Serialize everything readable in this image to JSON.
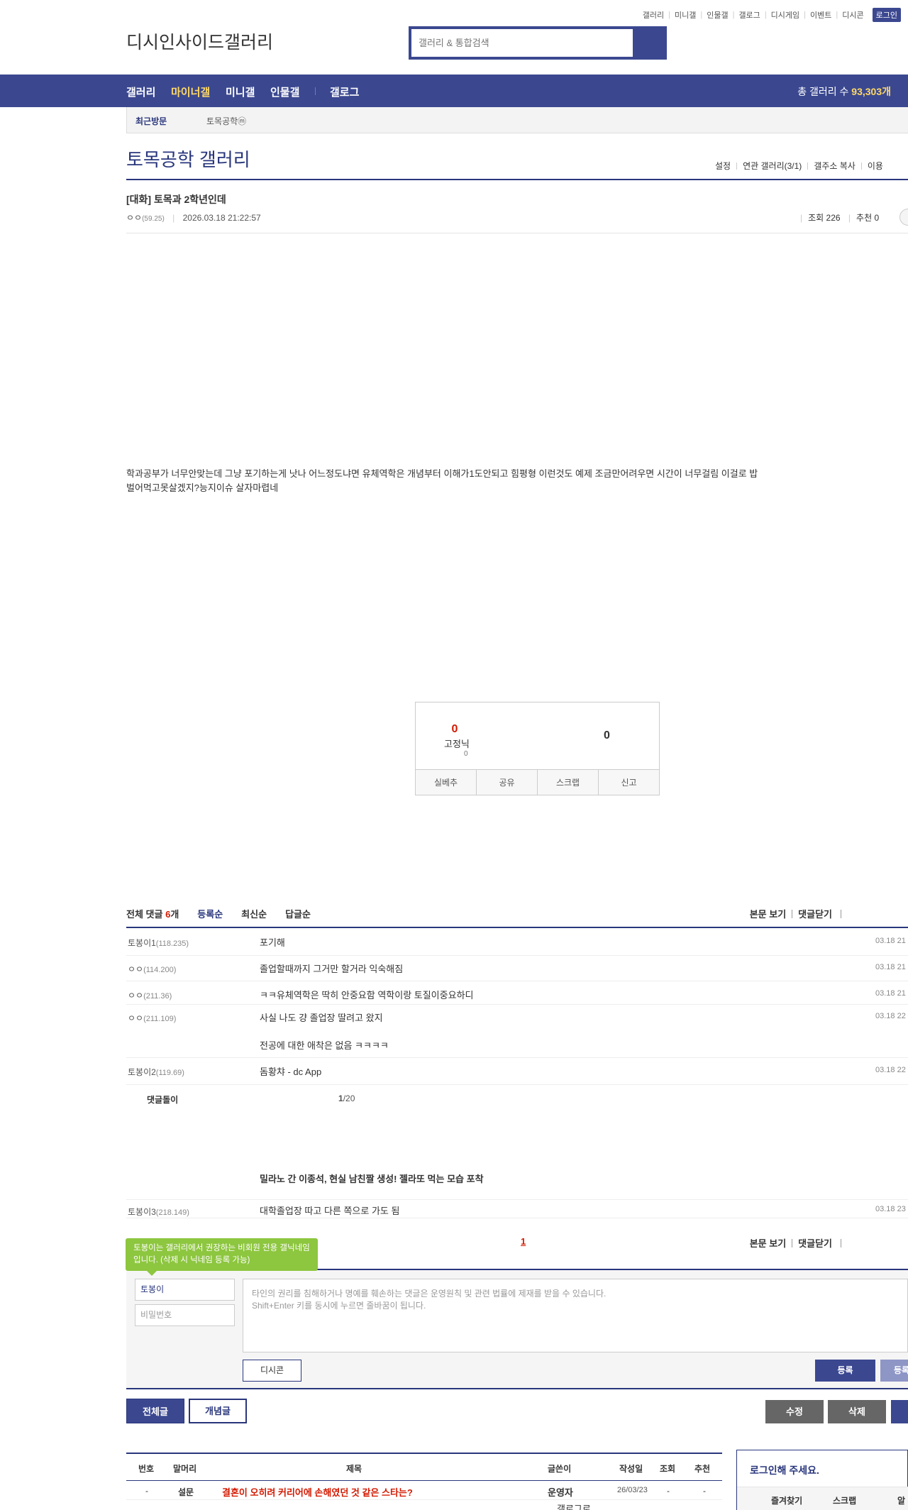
{
  "topnav": [
    "갤러리",
    "미니갤",
    "인물갤",
    "갤로그",
    "디시게임",
    "이벤트",
    "디시콘"
  ],
  "login_label": "로그인",
  "logo_alt": "디시인사이드",
  "logo_sub_alt": "갤러리",
  "search": {
    "placeholder": "갤러리 & 통합검색"
  },
  "gnb": {
    "items": [
      "갤러리",
      "마이너갤",
      "미니갤",
      "인물갤",
      "갤로그"
    ],
    "count_label": "총 갤러리 수",
    "count_value": "93,303개"
  },
  "recent": {
    "label": "최근방문",
    "item": "토목공학ⓜ"
  },
  "gallery": {
    "title": "토목공학 갤러리",
    "tools": [
      "설정",
      "연관 갤러리(3/1)",
      "갤주소 복사",
      "이용"
    ]
  },
  "post": {
    "title": "[대화] 토목과 2학년인데",
    "author": "ㅇㅇ",
    "author_ip": "(59.25)",
    "date": "2026.03.18 21:22:57",
    "views_label": "조회 226",
    "recommend_label": "추천 0",
    "body": "학과공부가 너무안맞는데 그냥 포기하는게 낫나 어느정도냐면 유체역학은 개념부터 이해가1도안되고 힘평형 이런것도 예제 조금만어려우면 시간이 너무걸림 이걸로 밥벌어먹고못살겠지?능지이슈 살자마렵네"
  },
  "recommend": {
    "up_count": "0",
    "fixed_alt": "고정닉",
    "fixed_count": "0",
    "down_count": "0",
    "buttons": [
      "실베추",
      "공유",
      "스크랩",
      "신고"
    ]
  },
  "comments": {
    "total_prefix": "전체 댓글",
    "total_count": "6",
    "total_suffix": "개",
    "sorts": [
      "등록순",
      "최신순",
      "답글순"
    ],
    "right": [
      "본문 보기",
      "댓글닫기"
    ],
    "rows": [
      {
        "nick": "토봉이1",
        "ip": "(118.235)",
        "memo": "포기해",
        "date": "03.18 21"
      },
      {
        "nick": "ㅇㅇ",
        "ip": "(114.200)",
        "memo": "졸업할때까지 그거만 할거라 익숙해짐",
        "date": "03.18 21"
      },
      {
        "nick": "ㅇㅇ",
        "ip": "(211.36)",
        "memo": "ㅋㅋ유체역학은 딱히 안중요함 역학이랑 토질이중요하디",
        "date": "03.18 21"
      },
      {
        "nick": "ㅇㅇ",
        "ip": "(211.109)",
        "memo": "사실 나도 걍 졸업장 딸려고 왔지",
        "memo2": "전공에 대한 애착은 없음 ㅋㅋㅋㅋ",
        "date": "03.18 22"
      },
      {
        "nick": "토봉이2",
        "ip": "(119.69)",
        "memo": "돔황챠 - dc App",
        "date": "03.18 22"
      }
    ],
    "dolphin_label": "댓글돌이",
    "dolphin_page": "1",
    "dolphin_total": "/20",
    "ad_text": "밀라노 간 이종석, 현실 남친짤 생성! 젤라또 먹는 모습 포착",
    "last_row": {
      "nick": "토봉이3",
      "ip": "(218.149)",
      "memo": "대학졸업장 따고 다른 쪽으로 가도 됨",
      "date": "03.18 23"
    },
    "page": "1"
  },
  "write": {
    "tooltip": "토봉이는 갤러리에서 권장하는 비회원 전용 갤닉네임입니다. (삭제 시 닉네임 등록 가능)",
    "nick_value": "토봉이",
    "password_placeholder": "비밀번호",
    "textarea_line1": "타인의 권리를 침해하거나 명예를 훼손하는 댓글은 운영원칙 및 관련 법률에 제재를 받을 수 있습니다.",
    "textarea_line2": "Shift+Enter 키를 동시에 누르면 줄바꿈이 됩니다.",
    "dccon_label": "디시콘",
    "submit_label": "등록",
    "submit2_label": "등록"
  },
  "bottom_buttons": {
    "all": "전체글",
    "concept": "개념글",
    "edit": "수정",
    "delete": "삭제"
  },
  "list": {
    "headers": [
      "번호",
      "말머리",
      "제목",
      "글쓴이",
      "작성일",
      "조회",
      "추천"
    ],
    "row": {
      "num": "-",
      "head": "설문",
      "title": "결혼이 오히려 커리어에 손해였던 것 같은 스타는?",
      "writer": "운영자",
      "date": "26/03/23",
      "views": "-",
      "rec": "-"
    },
    "gallog_alt": "갤로그로"
  },
  "loginbox": {
    "title": "로그인해 주세요.",
    "links": [
      "즐겨찾기",
      "스크랩",
      "알"
    ]
  }
}
